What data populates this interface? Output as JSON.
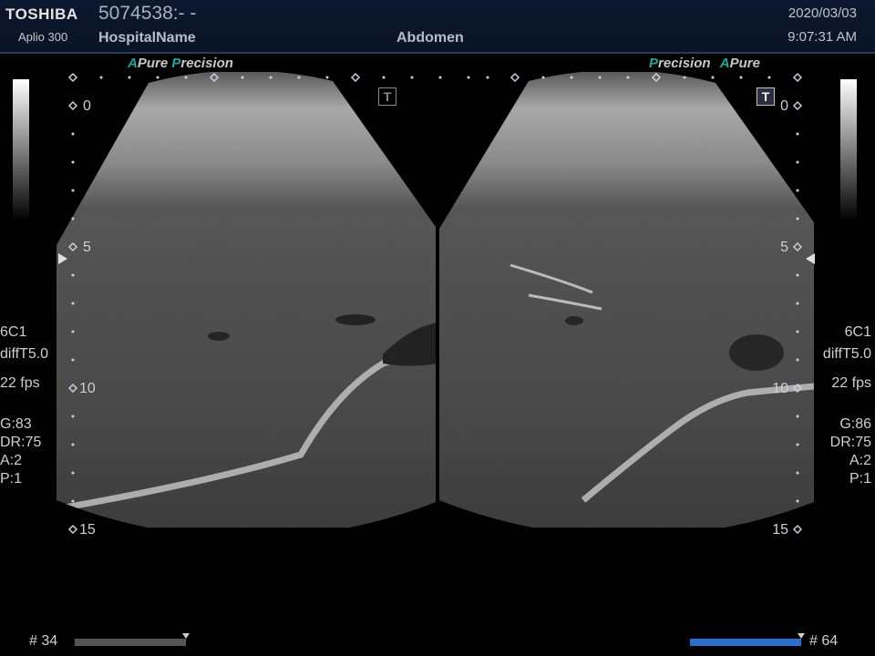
{
  "header": {
    "brand": "TOSHIBA",
    "model": "Aplio 300",
    "patient_id": "5074538:- -",
    "hospital_name": "HospitalName",
    "exam": "Abdomen",
    "date": "2020/03/03",
    "time": "9:07:31 AM"
  },
  "left_panel": {
    "labels": {
      "a": "A",
      "pure": "Pure",
      "p": "P",
      "recision": "recision"
    },
    "probe": "6C1",
    "filter": "diffT5.0",
    "frame_rate": "22 fps",
    "gain": "G:83",
    "dynamic_range": "DR:75",
    "a_value": "A:2",
    "p_value": "P:1",
    "depth_marks": [
      "0",
      "5",
      "10",
      "15"
    ],
    "cine_frame": "# 34",
    "cine_position": 1.0
  },
  "right_panel": {
    "labels": {
      "p": "P",
      "recision": "recision",
      "a": "A",
      "pure": "Pure"
    },
    "probe": "6C1",
    "filter": "diffT5.0",
    "frame_rate": "22 fps",
    "gain": "G:86",
    "dynamic_range": "DR:75",
    "a_value": "A:2",
    "p_value": "P:1",
    "depth_marks": [
      "0",
      "5",
      "10",
      "15"
    ],
    "cine_frame": "# 64",
    "cine_position": 1.0
  },
  "icons": {
    "left_t_icon": "T",
    "right_t_icon": "T"
  },
  "colors": {
    "accent": "#19a7a0",
    "header_bg": "#0c1830",
    "cine_left": "#555555",
    "cine_right": "#2a6fd0"
  }
}
